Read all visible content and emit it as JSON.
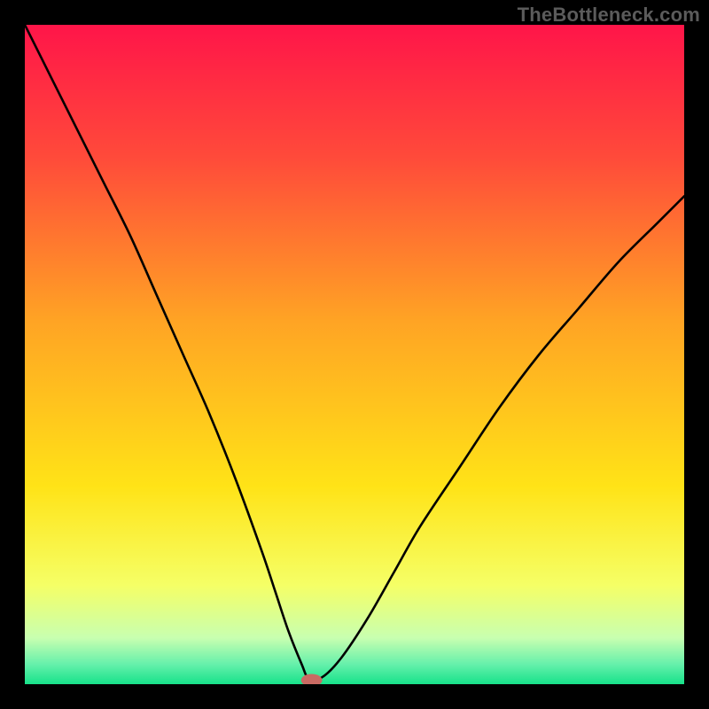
{
  "watermark": "TheBottleneck.com",
  "chart_data": {
    "type": "line",
    "title": "",
    "xlabel": "",
    "ylabel": "",
    "xlim": [
      0,
      100
    ],
    "ylim": [
      0,
      100
    ],
    "background_gradient": {
      "stops": [
        {
          "offset": 0,
          "color": "#ff1549"
        },
        {
          "offset": 20,
          "color": "#ff4a3a"
        },
        {
          "offset": 45,
          "color": "#ffa424"
        },
        {
          "offset": 70,
          "color": "#ffe317"
        },
        {
          "offset": 85,
          "color": "#f5ff66"
        },
        {
          "offset": 93,
          "color": "#c8ffb0"
        },
        {
          "offset": 97,
          "color": "#65f0ab"
        },
        {
          "offset": 100,
          "color": "#17e28a"
        }
      ]
    },
    "series": [
      {
        "name": "bottleneck-curve",
        "color": "#000000",
        "x": [
          0,
          4,
          8,
          12,
          16,
          20,
          24,
          28,
          32,
          36,
          38,
          40,
          42,
          43,
          45,
          48,
          52,
          56,
          60,
          66,
          72,
          78,
          84,
          90,
          96,
          100
        ],
        "y": [
          100,
          92,
          84,
          76,
          68,
          59,
          50,
          41,
          31,
          20,
          14,
          8,
          3,
          1,
          1,
          4,
          10,
          17,
          24,
          33,
          42,
          50,
          57,
          64,
          70,
          74
        ]
      }
    ],
    "marker": {
      "name": "optimal-point",
      "x": 43.5,
      "y": 0.6,
      "color": "#c96a63",
      "rx": 1.6,
      "ry": 0.95
    }
  }
}
